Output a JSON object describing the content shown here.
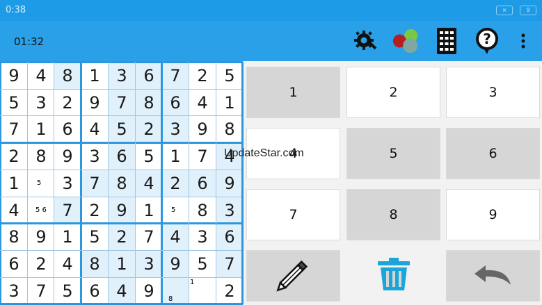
{
  "status_bar": {
    "time": "0:38",
    "battery": "9"
  },
  "app_bar": {
    "timer": "01:32",
    "icons": [
      "settings-icon",
      "colors-icon",
      "keypad-icon",
      "help-icon",
      "more-icon"
    ]
  },
  "grid": [
    [
      "9",
      "4",
      "8",
      "1",
      "3",
      "6",
      "7",
      "2",
      "5"
    ],
    [
      "5",
      "3",
      "2",
      "9",
      "7",
      "8",
      "6",
      "4",
      "1"
    ],
    [
      "7",
      "1",
      "6",
      "4",
      "5",
      "2",
      "3",
      "9",
      "8"
    ],
    [
      "2",
      "8",
      "9",
      "3",
      "6",
      "5",
      "1",
      "7",
      "4"
    ],
    [
      "1",
      "",
      "3",
      "7",
      "8",
      "4",
      "2",
      "6",
      "9"
    ],
    [
      "4",
      "",
      "7",
      "2",
      "9",
      "1",
      "",
      "8",
      "3"
    ],
    [
      "8",
      "9",
      "1",
      "5",
      "2",
      "7",
      "4",
      "3",
      "6"
    ],
    [
      "6",
      "2",
      "4",
      "8",
      "1",
      "3",
      "9",
      "5",
      "7"
    ],
    [
      "3",
      "7",
      "5",
      "6",
      "4",
      "9",
      "",
      "",
      "2"
    ]
  ],
  "notes": [
    {
      "r": 4,
      "c": 1,
      "text": "5"
    },
    {
      "r": 5,
      "c": 1,
      "text": "5 6"
    },
    {
      "r": 5,
      "c": 6,
      "text": "5"
    },
    {
      "r": 8,
      "c": 6,
      "text": "8"
    },
    {
      "r": 8,
      "c": 7,
      "text": "1"
    }
  ],
  "keypad": [
    "1",
    "2",
    "3",
    "4",
    "5",
    "6",
    "7",
    "8",
    "9"
  ],
  "tools": [
    "pencil-icon",
    "trash-icon",
    "undo-icon"
  ],
  "watermark": "UpdateStar.com",
  "colors": {
    "status_bar": "#1e9be6",
    "app_bar": "#2aa0e8",
    "thick_line": "#2c97de",
    "shade": "#e1f1fc"
  }
}
